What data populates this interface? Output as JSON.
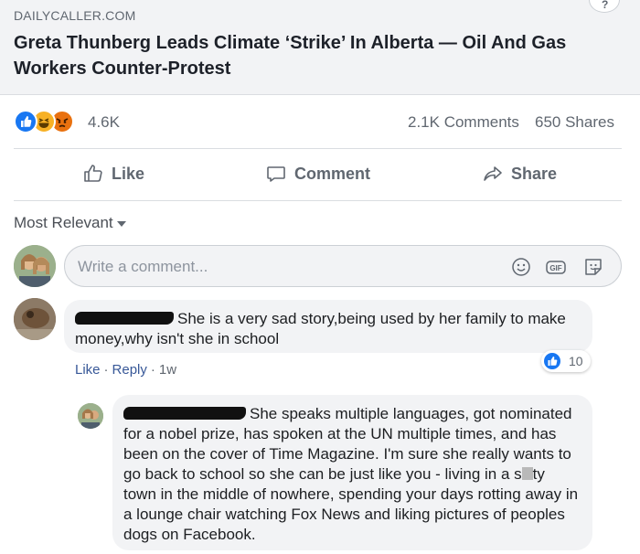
{
  "link": {
    "domain": "DAILYCALLER.COM",
    "headline": "Greta Thunberg Leads Climate ‘Strike’ In Alberta — Oil And Gas Workers Counter-Protest"
  },
  "stats": {
    "reactions": [
      "like",
      "haha",
      "angry"
    ],
    "reaction_count": "4.6K",
    "comments": "2.1K Comments",
    "shares": "650 Shares"
  },
  "actions": {
    "like": "Like",
    "comment": "Comment",
    "share": "Share"
  },
  "sort": {
    "label": "Most Relevant"
  },
  "composer": {
    "placeholder": "Write a comment..."
  },
  "comments": [
    {
      "text": "She is a very sad story,being used by her family to make money,why isn't she in school",
      "like_label": "Like",
      "reply_label": "Reply",
      "age": "1w",
      "likes": "10"
    },
    {
      "text_part1": "She speaks multiple languages, got nominated for a nobel prize, has spoken at the UN multiple times, and has been on the cover of Time Magazine. I'm sure she really wants to go back to school so she can be just like you - living in a s",
      "text_part2": "ty town in the middle of nowhere, spending your days rotting away in a lounge chair watching Fox News and liking pictures of peoples dogs on Facebook."
    }
  ],
  "colors": {
    "accent": "#1877f2",
    "link": "#385898",
    "muted": "#606770",
    "card_bg": "#f2f3f5"
  }
}
